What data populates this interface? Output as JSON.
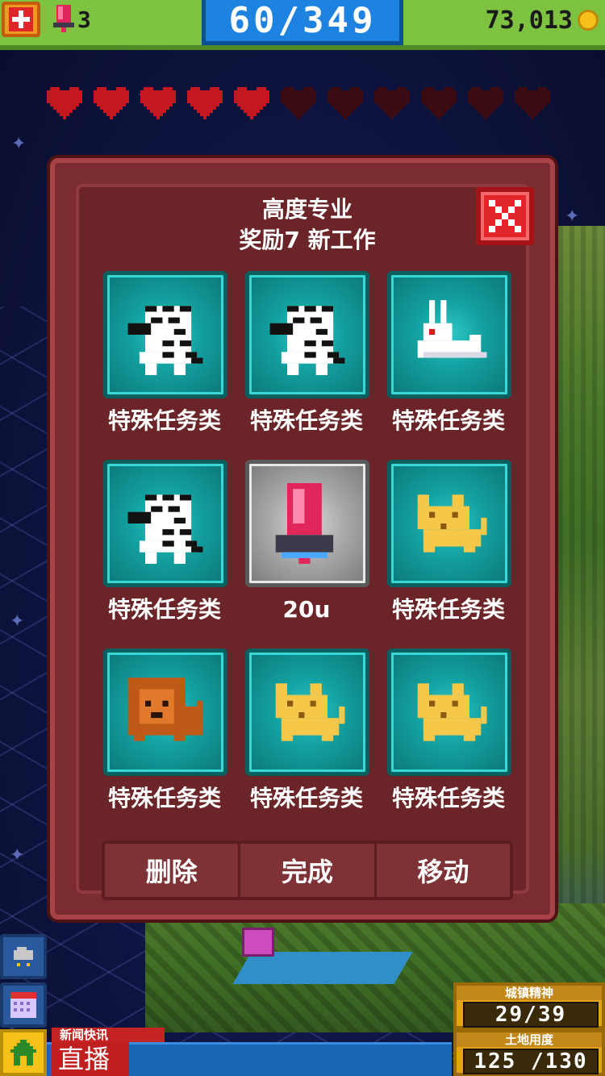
{
  "hud": {
    "bux_count": "3",
    "population": "60/349",
    "coins": "73,013"
  },
  "hearts": {
    "filled": 5,
    "total": 11,
    "filled_color": "#c41820",
    "empty_color": "#3a0c12"
  },
  "modal": {
    "title": "高度专业",
    "subtitle": "奖励7 新工作",
    "items": [
      {
        "label": "特殊任务类",
        "sprite": "zebra-icon",
        "tile": "teal"
      },
      {
        "label": "特殊任务类",
        "sprite": "zebra-icon",
        "tile": "teal"
      },
      {
        "label": "特殊任务类",
        "sprite": "rabbit-icon",
        "tile": "teal"
      },
      {
        "label": "特殊任务类",
        "sprite": "zebra-icon",
        "tile": "teal"
      },
      {
        "label": "20u",
        "sprite": "bux-icon",
        "tile": "gray"
      },
      {
        "label": "特殊任务类",
        "sprite": "yellow-cat-icon",
        "tile": "teal"
      },
      {
        "label": "特殊任务类",
        "sprite": "lion-icon",
        "tile": "teal"
      },
      {
        "label": "特殊任务类",
        "sprite": "yellow-cat-icon",
        "tile": "teal"
      },
      {
        "label": "特殊任务类",
        "sprite": "yellow-cat-icon",
        "tile": "teal"
      }
    ],
    "actions": {
      "delete": "删除",
      "complete": "完成",
      "move": "移动"
    }
  },
  "news": {
    "label": "新闻快讯",
    "text": "直播"
  },
  "stats": {
    "happiness_label": "城镇精神",
    "happiness_value": "29/39",
    "land_label": "土地用度",
    "land_value": "125 /130"
  },
  "colors": {
    "top_bar": "#7ec242",
    "population_box": "#1e82e0",
    "modal_bg": "#7a2c30",
    "tile_teal": "#14a1a1",
    "close_red": "#e0262a"
  }
}
